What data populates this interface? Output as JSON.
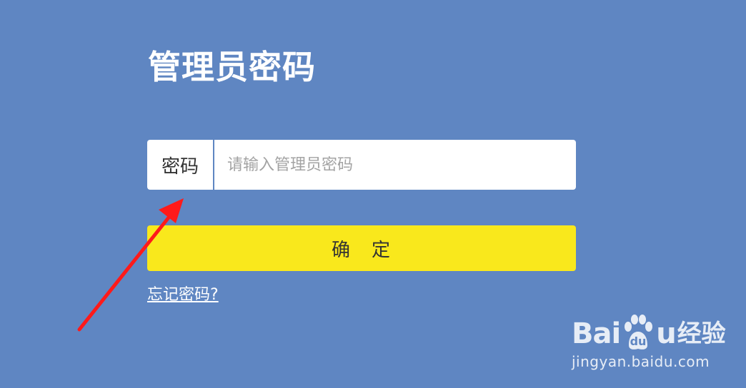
{
  "header": {
    "title": "管理员密码"
  },
  "form": {
    "password_label": "密码",
    "password_placeholder": "请输入管理员密码",
    "password_value": "",
    "confirm_label": "确　定",
    "forgot_link": "忘记密码?"
  },
  "watermark": {
    "brand_left": "Bai",
    "brand_right": "u",
    "brand_cn": "经验",
    "url": "jingyan.baidu.com",
    "paw_icon": "baidu-paw-icon"
  },
  "colors": {
    "background": "#5f86c2",
    "button": "#f9e81c",
    "arrow": "#ff1a1a"
  }
}
